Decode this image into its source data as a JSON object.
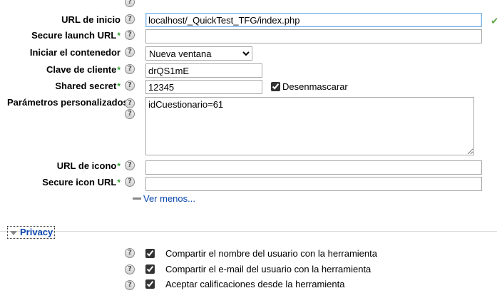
{
  "form": {
    "url_inicio": {
      "label": "URL de inicio",
      "value": "localhost/_QuickTest_TFG/index.php"
    },
    "secure_launch_url": {
      "label": "Secure launch URL",
      "required_mark": "*",
      "value": ""
    },
    "contenedor": {
      "label": "Iniciar el contenedor",
      "selected": "Nueva ventana"
    },
    "clave_cliente": {
      "label": "Clave de cliente",
      "required_mark": "*",
      "value": "drQS1mE"
    },
    "shared_secret": {
      "label": "Shared secret",
      "required_mark": "*",
      "value": "12345",
      "unmask_label": "Desenmascarar"
    },
    "parametros": {
      "label": "Parámetros personalizados",
      "required_mark": "*",
      "value": "idCuestionario=61"
    },
    "url_icono": {
      "label": "URL de icono",
      "required_mark": "*",
      "value": ""
    },
    "secure_icon_url": {
      "label": "Secure icon URL",
      "required_mark": "*",
      "value": ""
    },
    "ver_menos": "Ver menos..."
  },
  "privacy": {
    "legend": "Privacy",
    "options": [
      {
        "label": "Compartir el nombre del usuario con la herramienta",
        "checked": true
      },
      {
        "label": "Compartir el e-mail del usuario con la herramienta",
        "checked": true
      },
      {
        "label": "Aceptar calificaciones desde la herramienta",
        "checked": true
      }
    ]
  },
  "icons": {
    "help": "help-icon",
    "valid": "checkmark-icon",
    "collapse": "collapse-triangle-icon"
  }
}
